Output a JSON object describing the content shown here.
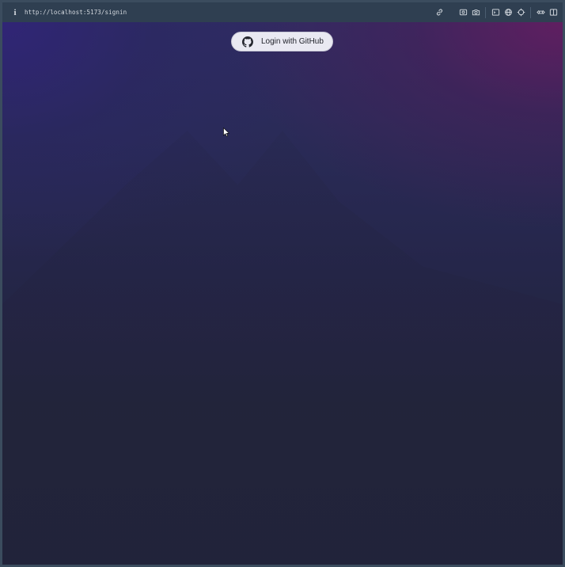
{
  "browser": {
    "info_icon": "info-icon",
    "url": "http://localhost:5173/signin",
    "toolbar_icons": [
      "link-icon",
      "screenshot-icon",
      "camera-icon",
      "terminal-icon",
      "globe-icon",
      "crosshair-icon",
      "devtools-icon",
      "sidebar-icon"
    ]
  },
  "page": {
    "login_button": {
      "label": "Login with GitHub",
      "icon": "github-icon"
    },
    "background_colors": {
      "top_left": "#2f2c62",
      "top_right": "#701a60",
      "bottom": "#21233a"
    }
  }
}
